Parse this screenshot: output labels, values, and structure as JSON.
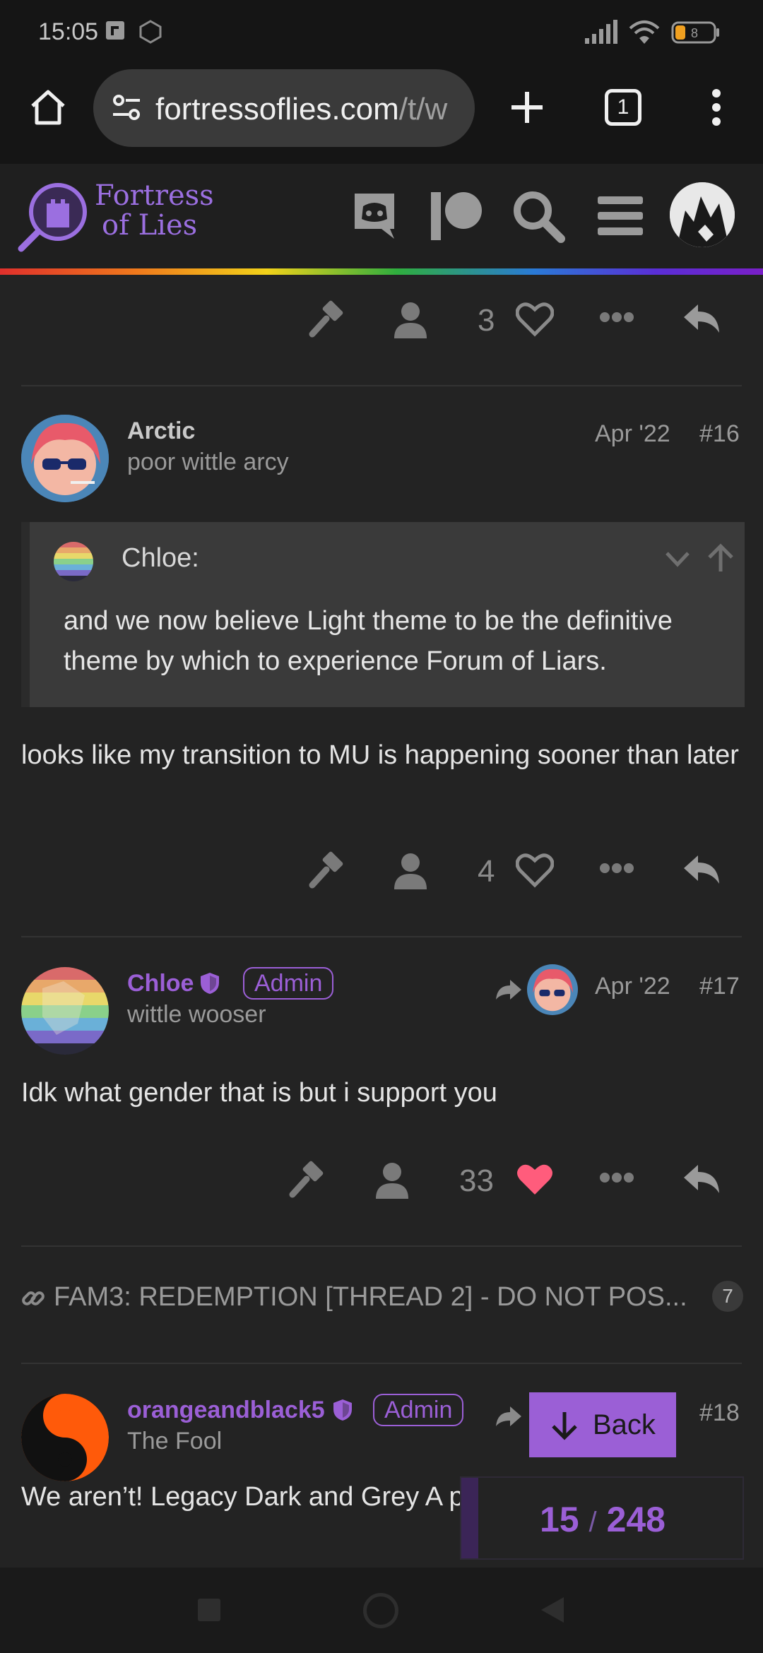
{
  "status_bar": {
    "time": "15:05",
    "battery": "8"
  },
  "browser": {
    "url_main": "fortressoflies.com",
    "url_rest": "/t/w",
    "tab_count": "1"
  },
  "site": {
    "logo_line1": "Fortress",
    "logo_line2": "of Lies"
  },
  "posts": [
    {
      "likes": "3"
    },
    {
      "username": "Arctic",
      "title": "poor wittle arcy",
      "date": "Apr '22",
      "number": "#16",
      "quote": {
        "author": "Chloe:",
        "text": "and we now believe Light theme to be the definitive theme by which to experience Forum of Liars."
      },
      "body": "looks like my transition to MU is happening sooner than later",
      "likes": "4"
    },
    {
      "username": "Chloe",
      "title": "wittle wooser",
      "badge": "Admin",
      "date": "Apr '22",
      "number": "#17",
      "body": "Idk what gender that is but i support you",
      "likes": "33"
    },
    {
      "username": "orangeandblack5",
      "title": "The Fool",
      "badge": "Admin",
      "number": "#18",
      "body": "We aren’t! Legacy Dark and Grey A perfectly functional"
    }
  ],
  "linked_topic": {
    "title": "FAM3: REDEMPTION [THREAD 2] - DO NOT POS...",
    "count": "7"
  },
  "back_button": {
    "label": "Back"
  },
  "progress": {
    "current": "15",
    "total": "248",
    "separator": "/",
    "fraction": 0.06
  },
  "colors": {
    "accent": "#9b5fd6",
    "like": "#ff5c7c"
  }
}
